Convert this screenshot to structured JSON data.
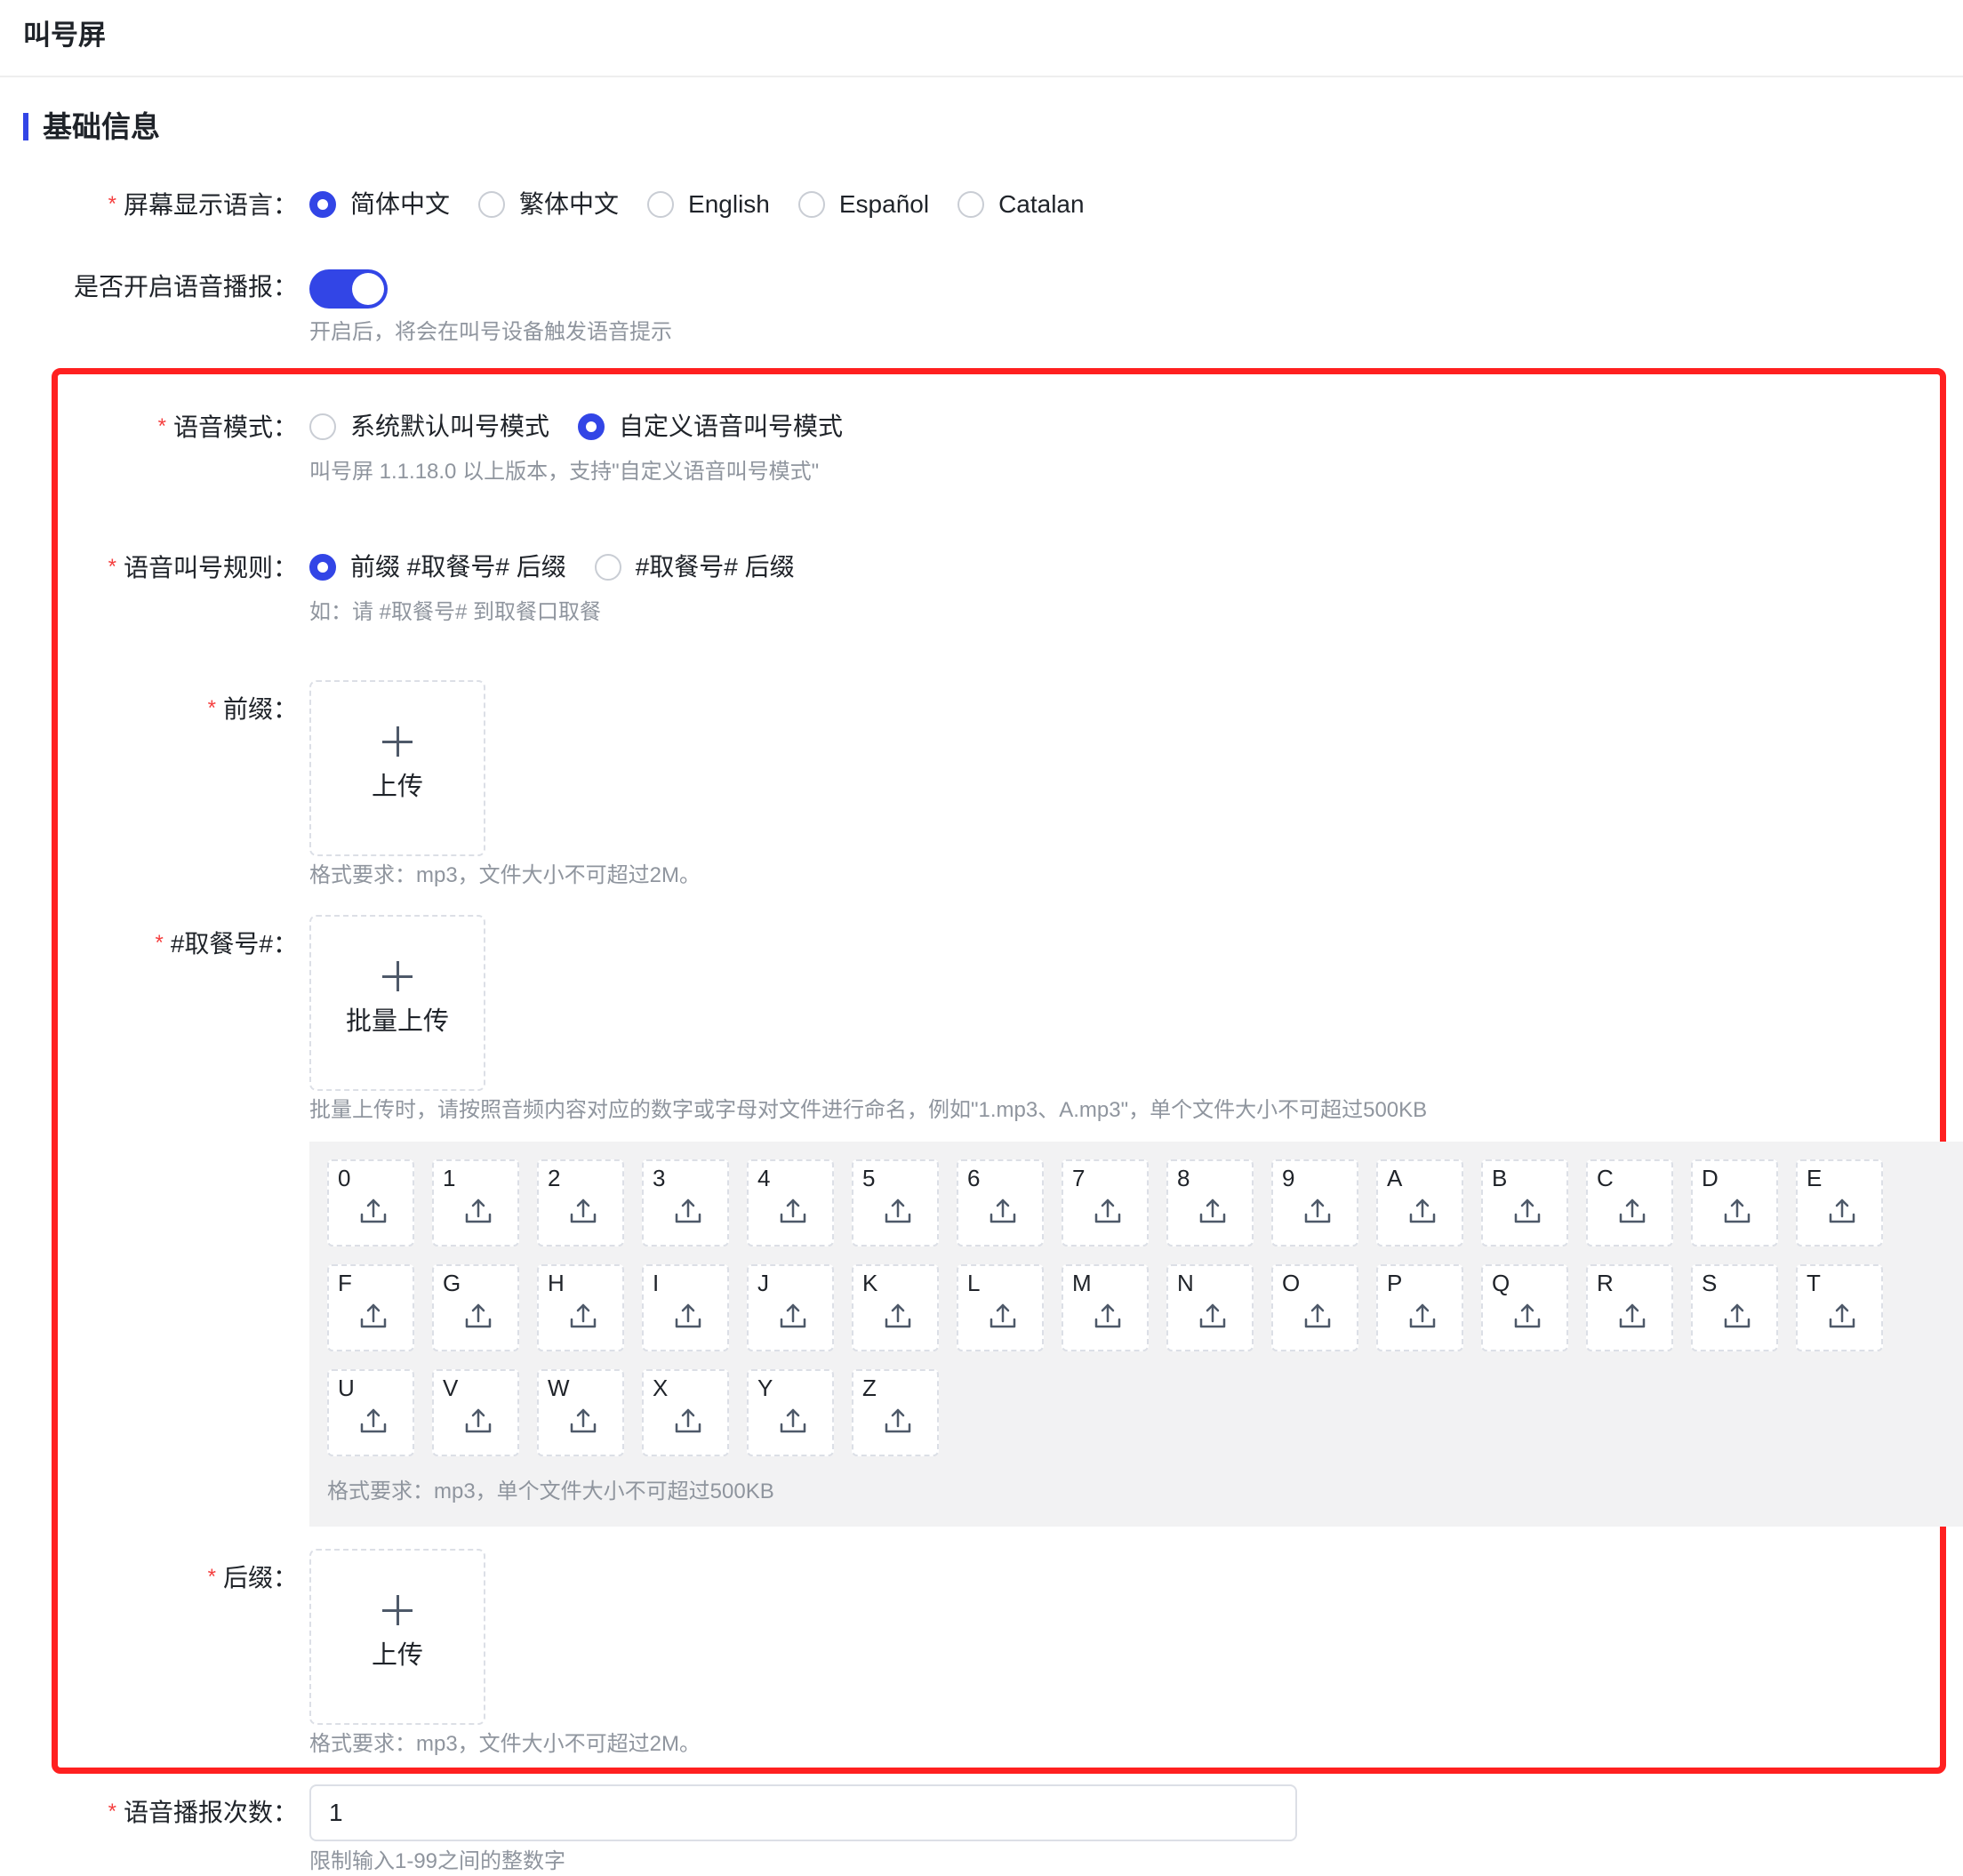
{
  "header": {
    "title": "叫号屏"
  },
  "section": {
    "title": "基础信息"
  },
  "colors": {
    "primary": "#3245e6",
    "required": "#f53f3f",
    "highlight_border": "#ff2020",
    "hint": "#8f959e"
  },
  "form": {
    "screen_language": {
      "label": "屏幕显示语言",
      "options": [
        "简体中文",
        "繁体中文",
        "English",
        "Español",
        "Catalan"
      ],
      "selected": "简体中文"
    },
    "voice_broadcast": {
      "label": "是否开启语音播报",
      "enabled": true,
      "hint": "开启后，将会在叫号设备触发语音提示"
    },
    "voice_mode": {
      "label": "语音模式",
      "options": [
        "系统默认叫号模式",
        "自定义语音叫号模式"
      ],
      "selected": "自定义语音叫号模式",
      "hint": "叫号屏 1.1.18.0 以上版本，支持\"自定义语音叫号模式\""
    },
    "voice_rule": {
      "label": "语音叫号规则",
      "options": [
        "前缀 #取餐号# 后缀",
        "#取餐号# 后缀"
      ],
      "selected": "前缀 #取餐号# 后缀",
      "hint": "如：请 #取餐号# 到取餐口取餐"
    },
    "prefix": {
      "label": "前缀",
      "upload_label": "上传",
      "hint": "格式要求：mp3，文件大小不可超过2M。"
    },
    "pickup_number": {
      "label": "#取餐号#",
      "upload_label": "批量上传",
      "hint": "批量上传时，请按照音频内容对应的数字或字母对文件进行命名，例如\"1.mp3、A.mp3\"，单个文件大小不可超过500KB",
      "characters": [
        "0",
        "1",
        "2",
        "3",
        "4",
        "5",
        "6",
        "7",
        "8",
        "9",
        "A",
        "B",
        "C",
        "D",
        "E",
        "F",
        "G",
        "H",
        "I",
        "J",
        "K",
        "L",
        "M",
        "N",
        "O",
        "P",
        "Q",
        "R",
        "S",
        "T",
        "U",
        "V",
        "W",
        "X",
        "Y",
        "Z"
      ],
      "char_icon": "upload-icon",
      "char_hint": "格式要求：mp3，单个文件大小不可超过500KB"
    },
    "suffix": {
      "label": "后缀",
      "upload_label": "上传",
      "hint": "格式要求：mp3，文件大小不可超过2M。"
    },
    "broadcast_count": {
      "label": "语音播报次数",
      "value": "1",
      "hint": "限制输入1-99之间的整数字"
    }
  }
}
